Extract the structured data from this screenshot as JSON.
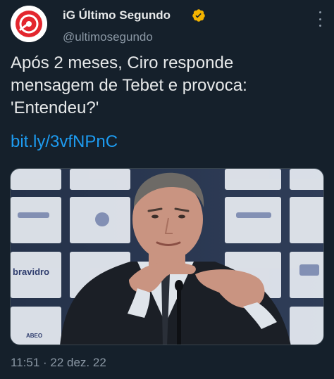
{
  "colors": {
    "background": "#15202b",
    "text_primary": "#e7e9ea",
    "text_secondary": "#8b98a5",
    "link": "#1d9bf0",
    "verified_badge": "#f4b400",
    "avatar_brand": "#e3262e"
  },
  "author": {
    "display_name": "iG Último Segundo",
    "handle": "@ultimosegundo",
    "verified_icon": "verified-badge-icon",
    "avatar_icon": "ig-logo-icon"
  },
  "tweet": {
    "text_lines": [
      "Após 2 meses, Ciro responde",
      "mensagem de Tebet e provoca:",
      "'Entendeu?'"
    ],
    "link": "bit.ly/3vfNPnC",
    "media": {
      "backdrop_texts": [
        "bravidro",
        "ABEO"
      ]
    },
    "timestamp": "11:51 · 22 dez. 22"
  },
  "menu": {
    "icon": "more-options-icon"
  }
}
